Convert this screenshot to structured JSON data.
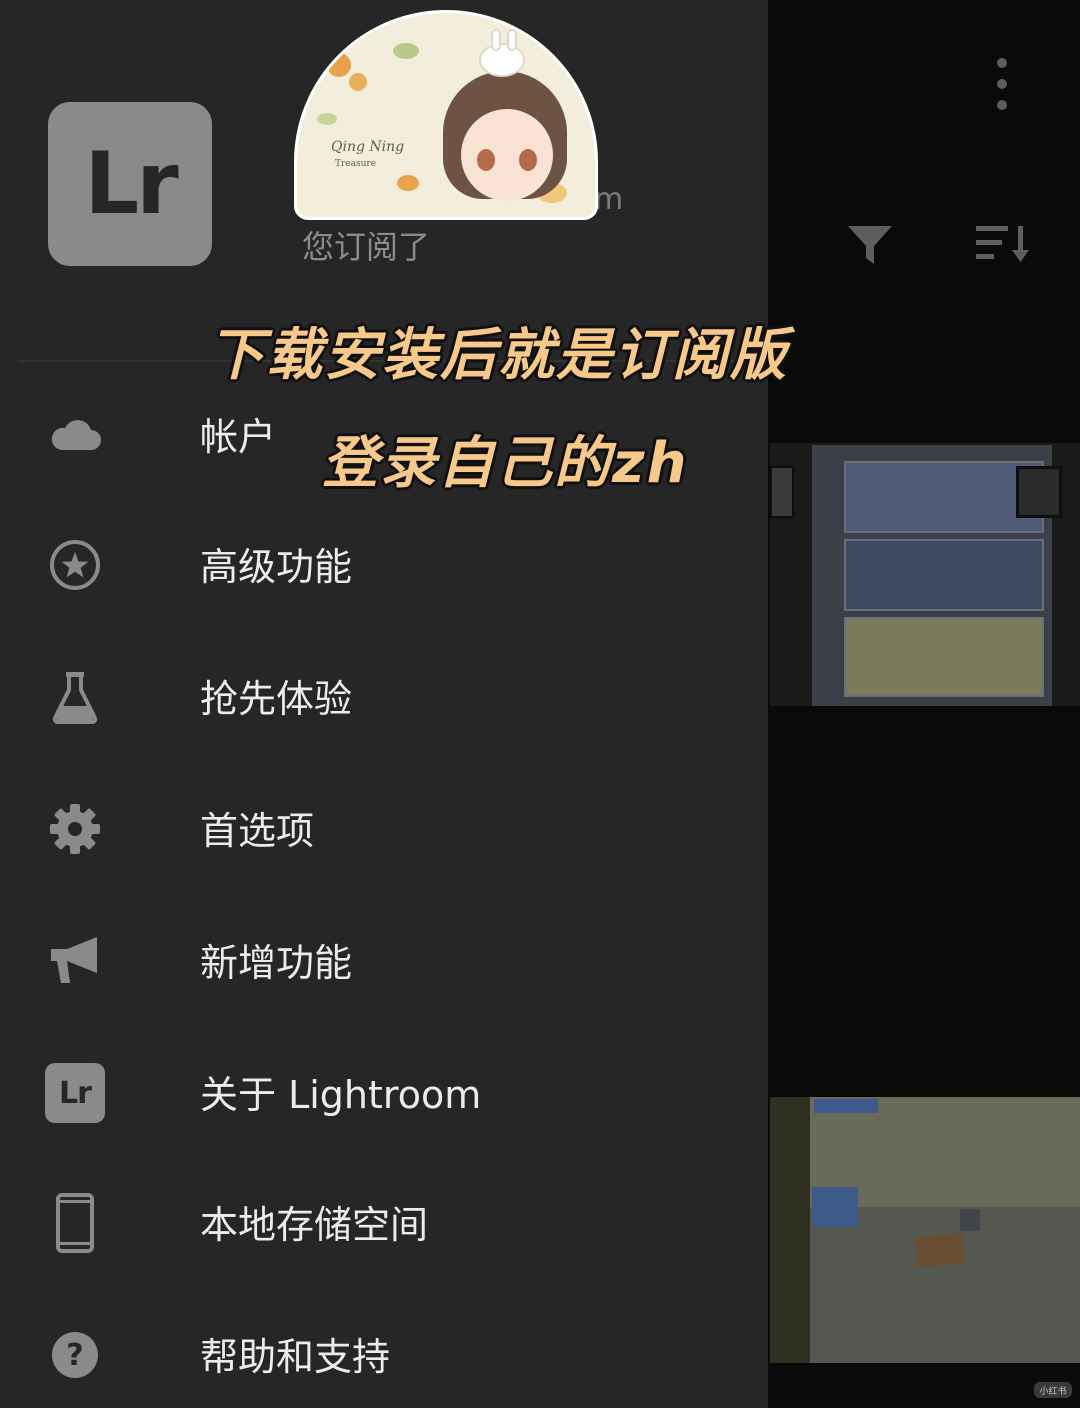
{
  "background": {
    "more_icon": "more-vertical-icon",
    "filter_icon": "filter-icon",
    "sort_icon": "sort-icon",
    "watermark": "小红书"
  },
  "drawer": {
    "app_logo_text": "Lr",
    "subscription_status": "您订阅了",
    "trailing_text": "m",
    "menu": [
      {
        "label": "帐户",
        "icon": "cloud-icon"
      },
      {
        "label": "高级功能",
        "icon": "star-circle-icon"
      },
      {
        "label": "抢先体验",
        "icon": "flask-icon"
      },
      {
        "label": "首选项",
        "icon": "gear-icon"
      },
      {
        "label": "新增功能",
        "icon": "megaphone-icon"
      },
      {
        "label": "关于 Lightroom",
        "icon": "lightroom-icon",
        "icon_text": "Lr"
      },
      {
        "label": "本地存储空间",
        "icon": "phone-icon"
      },
      {
        "label": "帮助和支持",
        "icon": "help-icon",
        "icon_text": "?"
      }
    ]
  },
  "avatar": {
    "signature": "Qing Ning",
    "signature_sub": "Treasure"
  },
  "overlay": {
    "caption_line1": "下载安装后就是订阅版",
    "caption_line2": "登录自己的zh"
  },
  "colors": {
    "drawer_bg": "#262626",
    "icon_gray": "#8a8a8a",
    "caption": "#f6c98a"
  }
}
